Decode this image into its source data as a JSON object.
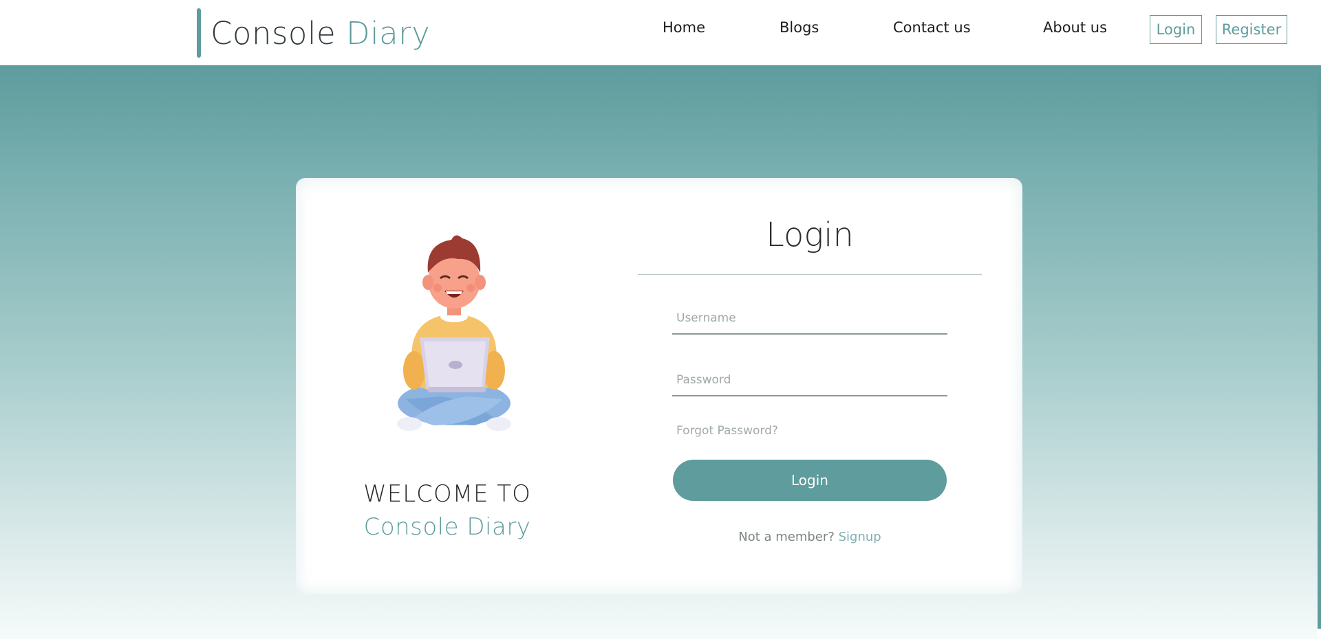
{
  "brand": {
    "prefix": "Console ",
    "accent": "Diary"
  },
  "nav": {
    "links": [
      "Home",
      "Blogs",
      "Contact us",
      "About us"
    ],
    "login_button": "Login",
    "register_button": "Register"
  },
  "welcome": {
    "line1": "WELCOME TO",
    "line2": "Console Diary"
  },
  "form": {
    "title": "Login",
    "username_placeholder": "Username",
    "password_placeholder": "Password",
    "forgot_link": "Forgot Password?",
    "submit_label": "Login",
    "signup_prompt": "Not a member?",
    "signup_link": "Signup"
  },
  "colors": {
    "accent": "#5e9c9d",
    "text": "#2b2b2b",
    "muted": "#a2a9a9"
  }
}
